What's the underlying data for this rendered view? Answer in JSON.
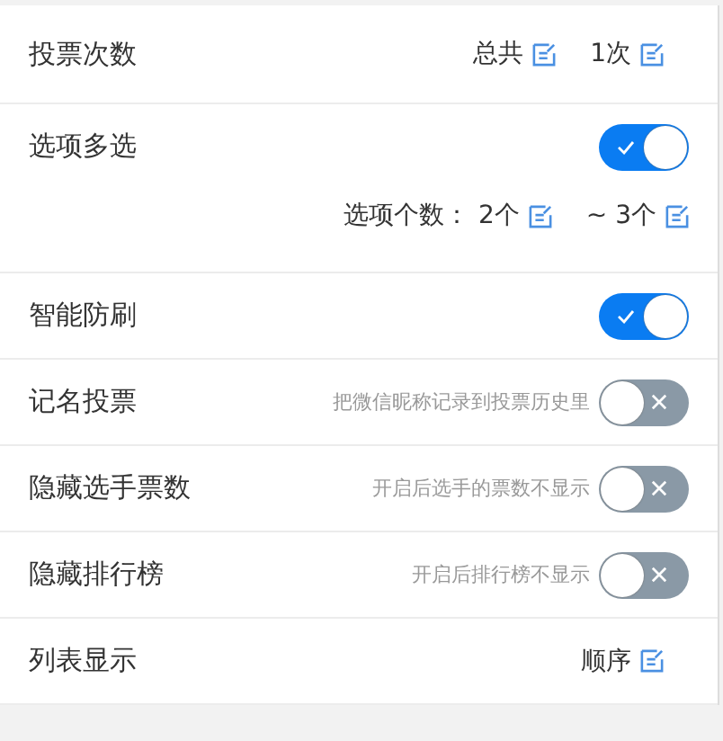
{
  "settings": [
    {
      "kind": "value",
      "label": "投票次数",
      "parts": [
        "总共",
        "1次"
      ]
    },
    {
      "kind": "toggle",
      "label": "选项多选",
      "on": true,
      "sub": {
        "label": "选项个数：",
        "parts": [
          "2个",
          "~ 3个"
        ]
      }
    },
    {
      "kind": "toggle",
      "label": "智能防刷",
      "on": true
    },
    {
      "kind": "toggle",
      "label": "记名投票",
      "hint": "把微信昵称记录到投票历史里",
      "on": false
    },
    {
      "kind": "toggle",
      "label": "隐藏选手票数",
      "hint": "开启后选手的票数不显示",
      "on": false
    },
    {
      "kind": "toggle",
      "label": "隐藏排行榜",
      "hint": "开启后排行榜不显示",
      "on": false
    },
    {
      "kind": "value",
      "label": "列表显示",
      "parts": [
        "顺序"
      ]
    }
  ]
}
